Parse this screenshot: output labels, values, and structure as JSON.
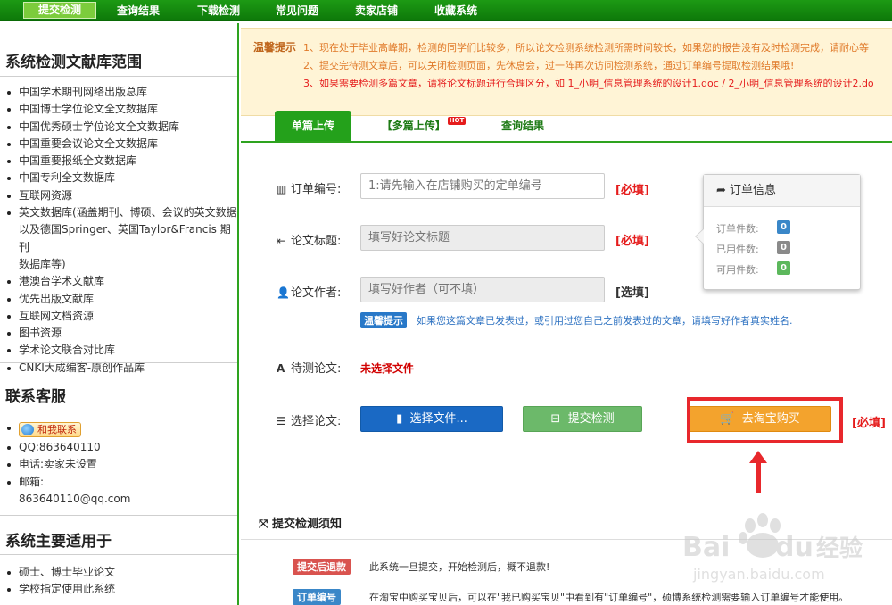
{
  "nav": {
    "items": [
      "提交检测",
      "查询结果",
      "下载检测",
      "常见问题",
      "卖家店铺",
      "收藏系统"
    ]
  },
  "sidebar": {
    "scope_title": "系统检测文献库范围",
    "scope_items": [
      "中国学术期刊网络出版总库",
      "中国博士学位论文全文数据库",
      "中国优秀硕士学位论文全文数据库",
      "中国重要会议论文全文数据库",
      "中国重要报纸全文数据库",
      "中国专利全文数据库",
      "互联网资源",
      "英文数据库(涵盖期刊、博硕、会议的英文数据",
      "以及德国Springer、英国Taylor&Francis 期刊",
      "数据库等)",
      "港澳台学术文献库",
      "优先出版文献库",
      "互联网文档资源",
      "图书资源",
      "学术论文联合对比库",
      "CNKI大成编客-原创作品库"
    ],
    "contact_title": "联系客服",
    "contact_button": "和我联系",
    "qq": "QQ:863640110",
    "phone": "电话:卖家未设置",
    "email_label": "邮箱:",
    "email": "863640110@qq.com",
    "usage_title": "系统主要适用于",
    "usage_items": [
      "硕士、博士毕业论文",
      "学校指定使用此系统"
    ]
  },
  "notice": {
    "label": "温馨提示",
    "line1": "1、现在处于毕业高峰期，检测的同学们比较多，所以论文检测系统检测所需时间较长，如果您的报告没有及时检测完成，请耐心等",
    "line2": "2、提交完待测文章后，可以关闭检测页面，先休息会，过一阵再次访问检测系统，通过订单编号提取检测结果哦!",
    "line3": "3、如果需要检测多篇文章，请将论文标题进行合理区分，如 1_小明_信息管理系统的设计1.doc / 2_小明_信息管理系统的设计2.do"
  },
  "tabs": {
    "single": "单篇上传",
    "multi": "【多篇上传】",
    "hot": "HOT",
    "query": "查询结果"
  },
  "form": {
    "order_label": "订单编号:",
    "order_placeholder": "1:请先输入在店铺购买的定单编号",
    "title_label": "论文标题:",
    "title_placeholder": "填写好论文标题",
    "author_label": "论文作者:",
    "author_placeholder": "填写好作者（可不填）",
    "required": "[必填]",
    "optional": "[选填]",
    "warm_badge": "温馨提示",
    "warm_text": "如果您这篇文章已发表过，或引用过您自己之前发表过的文章，请填写好作者真实姓名.",
    "pending_label": "待测论文:",
    "pending_value": "未选择文件",
    "choose_label": "选择论文:",
    "choose_button": "选择文件...",
    "submit_button": "提交检测",
    "buy_button": "去淘宝购买",
    "buy_required": "[必填]"
  },
  "order_panel": {
    "title": "订单信息",
    "rows": [
      {
        "label": "订单件数:",
        "value": "0",
        "color": "#3a87c8"
      },
      {
        "label": "已用件数:",
        "value": "0",
        "color": "#8a8a8a"
      },
      {
        "label": "可用件数:",
        "value": "0",
        "color": "#5cb85c"
      }
    ]
  },
  "instructions": {
    "title": "提交检测须知",
    "items": [
      {
        "tag": "提交后退款",
        "text": "此系统一旦提交，开始检测后，概不退款!",
        "color": "#d9534f"
      },
      {
        "tag": "订单编号",
        "text": "在淘宝中购买宝贝后，可以在\"我已购买宝贝\"中看到有\"订单编号\"，硕博系统检测需要输入订单编号才能使用。",
        "color": "#3a87c8"
      }
    ]
  },
  "watermark": {
    "brand": "Bai",
    "brand2": "du",
    "cn": "经验",
    "url": "jingyan.baidu.com"
  }
}
